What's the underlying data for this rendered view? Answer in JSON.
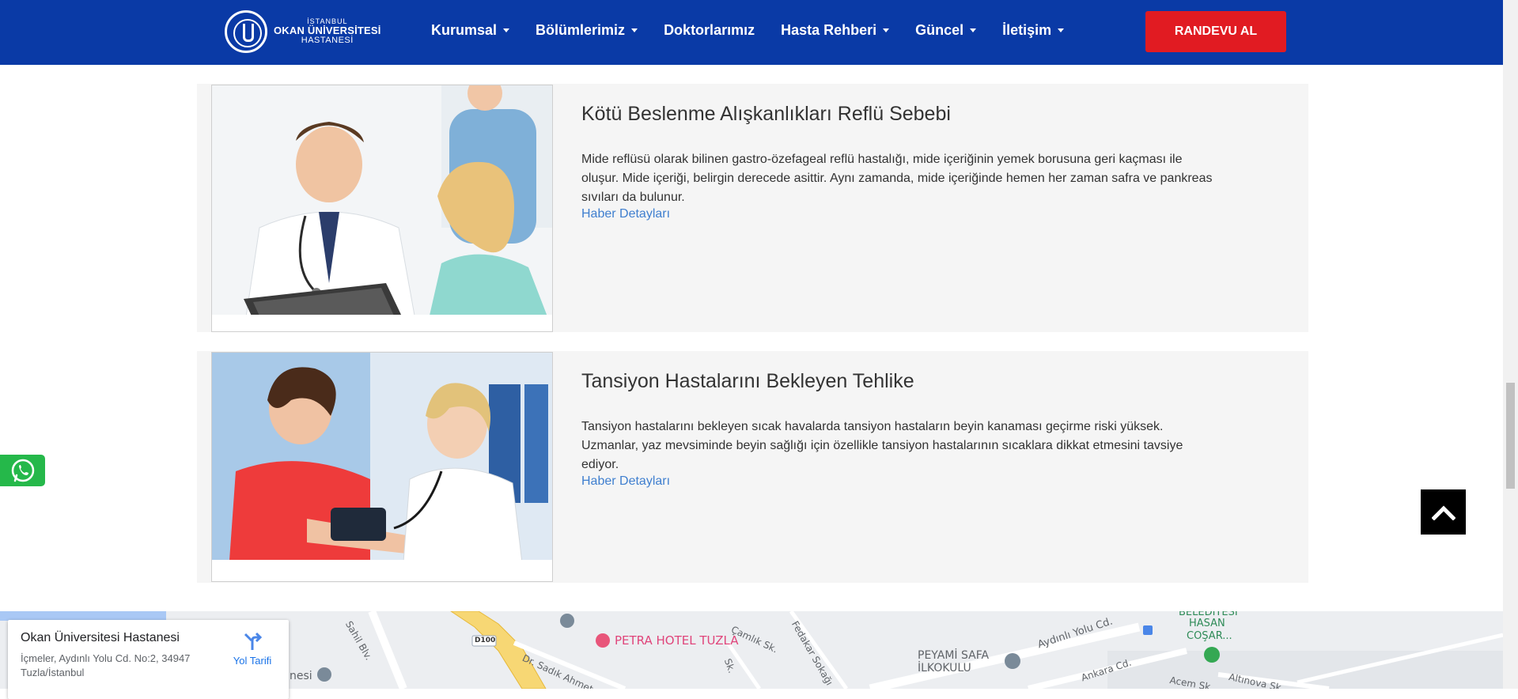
{
  "header": {
    "logo_line1": "İSTANBUL",
    "logo_line2": "OKAN ÜNİVERSİTESİ",
    "logo_line3": "HASTANESİ",
    "nav": [
      {
        "label": "Kurumsal",
        "dropdown": true
      },
      {
        "label": "Bölümlerimiz",
        "dropdown": true
      },
      {
        "label": "Doktorlarımız",
        "dropdown": false
      },
      {
        "label": "Hasta Rehberi",
        "dropdown": true
      },
      {
        "label": "Güncel",
        "dropdown": true
      },
      {
        "label": "İletişim",
        "dropdown": true
      }
    ],
    "cta_label": "RANDEVU AL",
    "colors": {
      "background": "#0a3aa6",
      "cta": "#e11b22"
    }
  },
  "news": [
    {
      "title": "Kötü Beslenme Alışkanlıkları Reflü Sebebi",
      "text": "Mide reflüsü olarak bilinen gastro-özefageal reflü hastalığı, mide içeriğinin yemek borusuna geri kaçması ile oluşur. Mide içeriği, belirgin derecede asittir. Aynı zamanda, mide içeriğinde hemen her zaman safra ve pankreas sıvıları da bulunur.",
      "link": "Haber Detayları"
    },
    {
      "title": "Tansiyon Hastalarını Bekleyen Tehlike",
      "text": "Tansiyon hastalarını bekleyen sıcak havalarda tansiyon hastaların beyin kanaması geçirme riski yüksek. Uzmanlar, yaz mevsiminde beyin sağlığı için özellikle tansiyon hastalarının sıcaklara dikkat etmesini tavsiye ediyor.",
      "link": "Haber Detayları"
    }
  ],
  "map": {
    "place_name": "Okan Üniversitesi Hastanesi",
    "address_line1": "İçmeler, Aydınlı Yolu Cd. No:2, 34947",
    "address_line2": "Tuzla/İstanbul",
    "directions_label": "Yol Tarifi",
    "labels": {
      "hotel": "PETRA HOTEL TUZLA",
      "school1": "PEYAMİ SAFA",
      "school2": "İLKOKULU",
      "road_d100": "D100",
      "street1": "Sahil Blv.",
      "street2": "Dr. Sadık Ahmet Cd.",
      "street3": "Çamlık Sk.",
      "street4": "Fedakar Sokağı",
      "street5": "Aydınlı Yolu Cd.",
      "street6": "Ankara Cd.",
      "street7": "Acem Sk.",
      "street8": "Altınova Sk.",
      "poi1": "BELEDİYESİ",
      "poi2": "HASAN",
      "poi3": "COŞAR...",
      "poi_left": "nesi",
      "street_sk": "Sk."
    }
  },
  "icons": {
    "whatsapp": "whatsapp-icon",
    "back_to_top": "chevron-up-icon",
    "directions": "directions-icon"
  }
}
